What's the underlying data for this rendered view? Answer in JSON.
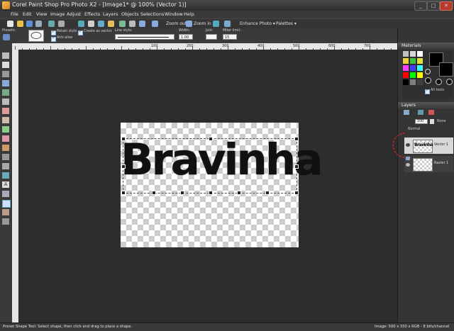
{
  "window": {
    "title": "Corel Paint Shop Pro Photo X2 - [Image1* @ 100% (Vector 1)]",
    "minimize": "_",
    "maximize": "□",
    "close": "✕"
  },
  "menu": [
    "File",
    "Edit",
    "View",
    "Image",
    "Adjust",
    "Effects",
    "Layers",
    "Objects",
    "Selections",
    "Window",
    "Help"
  ],
  "toolbar": {
    "zoom_out": "Zoom out",
    "zoom_in": "Zoom in",
    "enhance_photo": "Enhance Photo",
    "palettes": "Palettes"
  },
  "tool_options": {
    "presets_label": "Presets:",
    "retain_style": "Retain style",
    "create_as_vector": "Create as vector",
    "anti_alias": "Anti-alias",
    "line_style_label": "Line style:",
    "width_label": "Width:",
    "width_value": "1.00",
    "join_label": "Join:",
    "miter_limit_label": "Miter limit:",
    "miter_limit_value": "15"
  },
  "ruler": {
    "marks": [
      "100",
      "200",
      "300",
      "400",
      "500",
      "600",
      "700"
    ]
  },
  "canvas": {
    "text": "Bravinha"
  },
  "materials": {
    "title": "Materials",
    "all_tools": "All tools",
    "swatches": [
      "#c0c0c0",
      "#d8d8d8",
      "#ffffff",
      "#f0d040",
      "#40c040",
      "#e0e040",
      "#ff40ff",
      "#4040ff",
      "#40ffff",
      "#ff0000",
      "#00ff00",
      "#ffff00",
      "#000000",
      "#808080",
      "#404040"
    ]
  },
  "layers": {
    "title": "Layers",
    "opacity": "100",
    "mask_mode": "None",
    "blend_mode": "Normal",
    "items": [
      {
        "name": "Vector 1",
        "thumb_text": "Bravinha"
      },
      {
        "name": "Raster 1",
        "thumb_text": ""
      }
    ]
  },
  "status": {
    "left": "Preset Shape Tool: Select shape, then click and drag to place a shape.",
    "right": "Image:  500 x 350 x RGB - 8 bits/channel"
  }
}
